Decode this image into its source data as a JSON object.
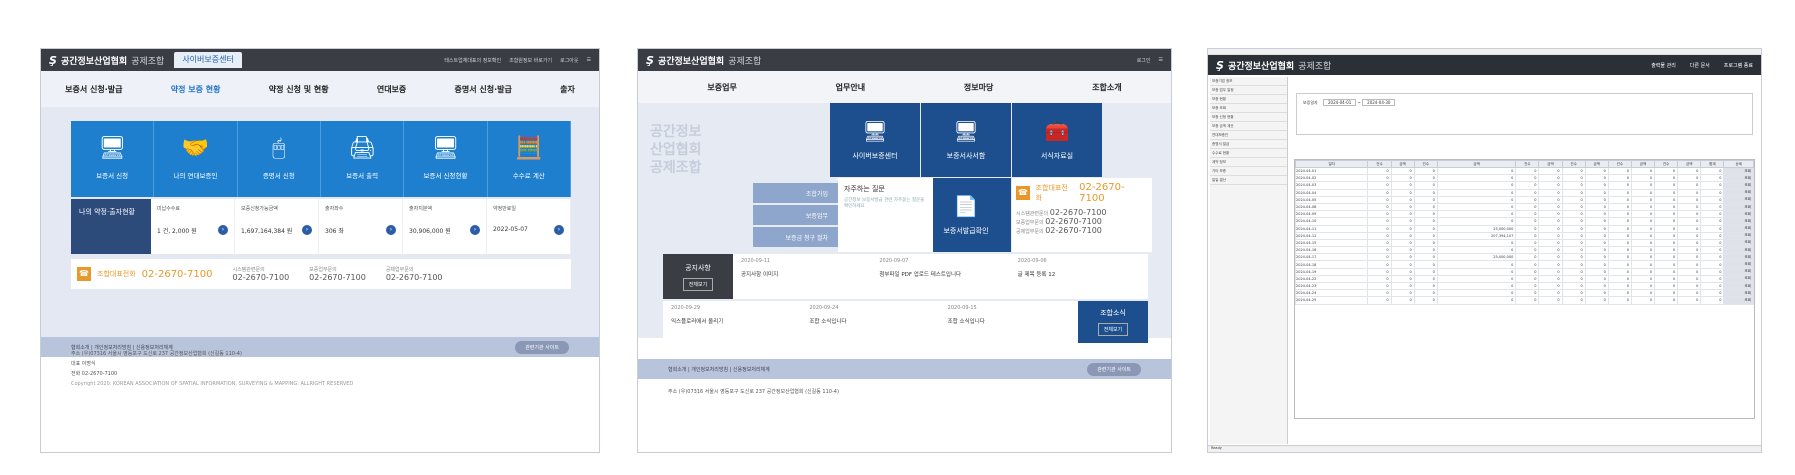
{
  "s1": {
    "logo": "공간정보산업협회",
    "logo_sub": "공제조합",
    "active_tab": "사이버보증센터",
    "user": "테스트업체대표의 정보확인",
    "user_links": [
      "조합원정보 바로가기",
      "로그아웃"
    ],
    "nav": [
      "보증서 신청·발급",
      "약정 보증 현황",
      "약정 신청 및 현황",
      "연대보증",
      "증명서 신청·발급",
      "출자"
    ],
    "tiles": [
      {
        "label": "보증서 신청",
        "icon": "🖥"
      },
      {
        "label": "나의 연대보증인",
        "icon": "🤝"
      },
      {
        "label": "증명서 신청",
        "icon": "🖱"
      },
      {
        "label": "보증서 출력",
        "icon": "🖨"
      },
      {
        "label": "보증서 신청현황",
        "icon": "🖥"
      },
      {
        "label": "수수료 계산",
        "icon": "🧮"
      }
    ],
    "my_title": "나의 약정·출자현황",
    "stats": [
      {
        "label": "미납수수료",
        "value": "1 건, 2,000 원"
      },
      {
        "label": "보증신청가능금액",
        "value": "1,697,164,384 원"
      },
      {
        "label": "출자좌수",
        "value": "306 좌"
      },
      {
        "label": "출자지분액",
        "value": "30,906,000 원"
      },
      {
        "label": "약정만료일",
        "value": "2022-05-07"
      }
    ],
    "call_label": "조합대표전화",
    "call_num": "02-2670-7100",
    "contacts": [
      {
        "label": "시스템관련문의",
        "num": "02-2670-7100"
      },
      {
        "label": "보증업무문의",
        "num": "02-2670-7100"
      },
      {
        "label": "공제업무문의",
        "num": "02-2670-7100"
      }
    ],
    "foot_links": "협회소개 | 개인정보처리방침 | 신용정보처리체계",
    "foot_pill": "관련기관 사이트",
    "addr": [
      "주소    (우)07316 서울시 영등포구 도신로 237 공간정보산업협회 (신길동 110-4)",
      "대표    이명식",
      "전화    02-2670-7100",
      "Copyright 2020. KOREAN ASSOCIATION OF SPATIAL INFORMATION, SURVEYING & MAPPING. ALLRIGHT RESERVED"
    ]
  },
  "s2": {
    "logo": "공간정보산업협회",
    "logo_sub": "공제조합",
    "top_links": [
      "로그인"
    ],
    "nav": [
      "보증업무",
      "업무안내",
      "정보마당",
      "조합소개"
    ],
    "hero": [
      "공간정보",
      "산업협회",
      "공제조합"
    ],
    "tiles": [
      {
        "label": "사이버보증센터",
        "icon": "🖥"
      },
      {
        "label": "보증서사서함",
        "icon": "🖥"
      },
      {
        "label": "서식자료실",
        "icon": "🧰"
      },
      {
        "label": "보증서발급확인",
        "icon": "📄"
      }
    ],
    "services": [
      "조합가입",
      "보증업무",
      "보증금 청구 절차"
    ],
    "faq_title": "자주하는 질문",
    "faq_sub": "공간정보 보증서발급 관련 자주묻는 질문을 확인하세요",
    "call_label": "조합대표전화",
    "call_num": "02-2670-7100",
    "contacts": [
      {
        "label": "시스템관련문의",
        "num": "02-2670-7100"
      },
      {
        "label": "보증업무문의",
        "num": "02-2670-7100"
      },
      {
        "label": "공제업무문의",
        "num": "02-2670-7100"
      }
    ],
    "notice_title": "공지사항",
    "notice_btn": "전체보기",
    "notices": [
      {
        "date": "2020-09-11",
        "title": "공지사항 이미지"
      },
      {
        "date": "2020-09-07",
        "title": "첨부파일 PDF 업로드 테스트입니다"
      },
      {
        "date": "2020-09-06",
        "title": "글 제목 등록 12"
      }
    ],
    "news_title": "조합소식",
    "news_btn": "전체보기",
    "news": [
      {
        "date": "2020-09-29",
        "title": "익스플로러에서 올리기"
      },
      {
        "date": "2020-09-24",
        "title": "조합 소식입니다"
      },
      {
        "date": "2020-09-15",
        "title": "조합 소식입니다"
      }
    ],
    "foot_links": "협회소개 | 개인정보처리방침 | 신용정보처리체계",
    "foot_pill": "관련기관 사이트",
    "addr": "주소 (우)07316 서울시 영등포구 도신로 237 공간정보산업협회 (신길동 110-4)"
  },
  "s3": {
    "logo": "공간정보산업협회",
    "logo_sub": "공제조합",
    "toolbar": [
      "출력물 관리",
      "다른 문서",
      "프로그램 종료"
    ],
    "side_items": [
      "보증기업 정보",
      "보증 업무 일정",
      "보증 현황",
      "보증 조회",
      "보증 신청 현황",
      "보증 금액 계산",
      "연대보증인",
      "증명서 발급",
      "수수료 현황",
      "계약 정보",
      "기타 보증",
      "일일 결산"
    ],
    "filter_label": "보증일자",
    "date_from": "2024-04-01",
    "date_to": "2024-04-30",
    "grid_headers": [
      "일자",
      "건수",
      "금액",
      "건수",
      "금액",
      "건수",
      "금액",
      "건수",
      "금액",
      "건수",
      "금액",
      "건수",
      "금액",
      "합계",
      "상세"
    ],
    "rows": [
      [
        "2024-04-01",
        "0",
        "0",
        "0",
        "0",
        "0",
        "0",
        "0",
        "0",
        "0",
        "0",
        "0",
        "0",
        "0",
        "조회"
      ],
      [
        "2024-04-02",
        "0",
        "0",
        "0",
        "0",
        "0",
        "0",
        "0",
        "0",
        "0",
        "0",
        "0",
        "0",
        "0",
        "조회"
      ],
      [
        "2024-04-03",
        "0",
        "0",
        "0",
        "0",
        "0",
        "0",
        "0",
        "0",
        "0",
        "0",
        "0",
        "0",
        "0",
        "조회"
      ],
      [
        "2024-04-04",
        "0",
        "0",
        "0",
        "0",
        "0",
        "0",
        "0",
        "0",
        "0",
        "0",
        "0",
        "0",
        "0",
        "조회"
      ],
      [
        "2024-04-05",
        "0",
        "0",
        "0",
        "0",
        "0",
        "0",
        "0",
        "0",
        "0",
        "0",
        "0",
        "0",
        "0",
        "조회"
      ],
      [
        "2024-04-08",
        "0",
        "0",
        "0",
        "0",
        "0",
        "0",
        "0",
        "0",
        "0",
        "0",
        "0",
        "0",
        "0",
        "조회"
      ],
      [
        "2024-04-09",
        "0",
        "0",
        "0",
        "0",
        "0",
        "0",
        "0",
        "0",
        "0",
        "0",
        "0",
        "0",
        "0",
        "조회"
      ],
      [
        "2024-04-10",
        "0",
        "0",
        "0",
        "0",
        "0",
        "0",
        "0",
        "0",
        "0",
        "0",
        "0",
        "0",
        "0",
        "조회"
      ],
      [
        "2024-04-11",
        "0",
        "0",
        "0",
        "25,000,000",
        "0",
        "0",
        "0",
        "0",
        "0",
        "0",
        "0",
        "0",
        "0",
        "조회"
      ],
      [
        "2024-04-12",
        "0",
        "0",
        "0",
        "207,394,107",
        "0",
        "0",
        "0",
        "0",
        "0",
        "0",
        "0",
        "0",
        "0",
        "조회"
      ],
      [
        "2024-04-15",
        "0",
        "0",
        "0",
        "0",
        "0",
        "0",
        "0",
        "0",
        "0",
        "0",
        "0",
        "0",
        "0",
        "조회"
      ],
      [
        "2024-04-16",
        "0",
        "0",
        "0",
        "0",
        "0",
        "0",
        "0",
        "0",
        "0",
        "0",
        "0",
        "0",
        "0",
        "조회"
      ],
      [
        "2024-04-17",
        "0",
        "0",
        "0",
        "25,000,000",
        "0",
        "0",
        "0",
        "0",
        "0",
        "0",
        "0",
        "0",
        "0",
        "조회"
      ],
      [
        "2024-04-18",
        "0",
        "0",
        "0",
        "0",
        "0",
        "0",
        "0",
        "0",
        "0",
        "0",
        "0",
        "0",
        "0",
        "조회"
      ],
      [
        "2024-04-19",
        "0",
        "0",
        "0",
        "0",
        "0",
        "0",
        "0",
        "0",
        "0",
        "0",
        "0",
        "0",
        "0",
        "조회"
      ],
      [
        "2024-04-22",
        "0",
        "0",
        "0",
        "0",
        "0",
        "0",
        "0",
        "0",
        "0",
        "0",
        "0",
        "0",
        "0",
        "조회"
      ],
      [
        "2024-04-23",
        "0",
        "0",
        "0",
        "0",
        "0",
        "0",
        "0",
        "0",
        "0",
        "0",
        "0",
        "0",
        "0",
        "조회"
      ],
      [
        "2024-04-24",
        "0",
        "0",
        "0",
        "0",
        "0",
        "0",
        "0",
        "0",
        "0",
        "0",
        "0",
        "0",
        "0",
        "조회"
      ],
      [
        "2024-04-25",
        "0",
        "0",
        "0",
        "0",
        "0",
        "0",
        "0",
        "0",
        "0",
        "0",
        "0",
        "0",
        "0",
        "조회"
      ]
    ],
    "status": "Ready"
  }
}
